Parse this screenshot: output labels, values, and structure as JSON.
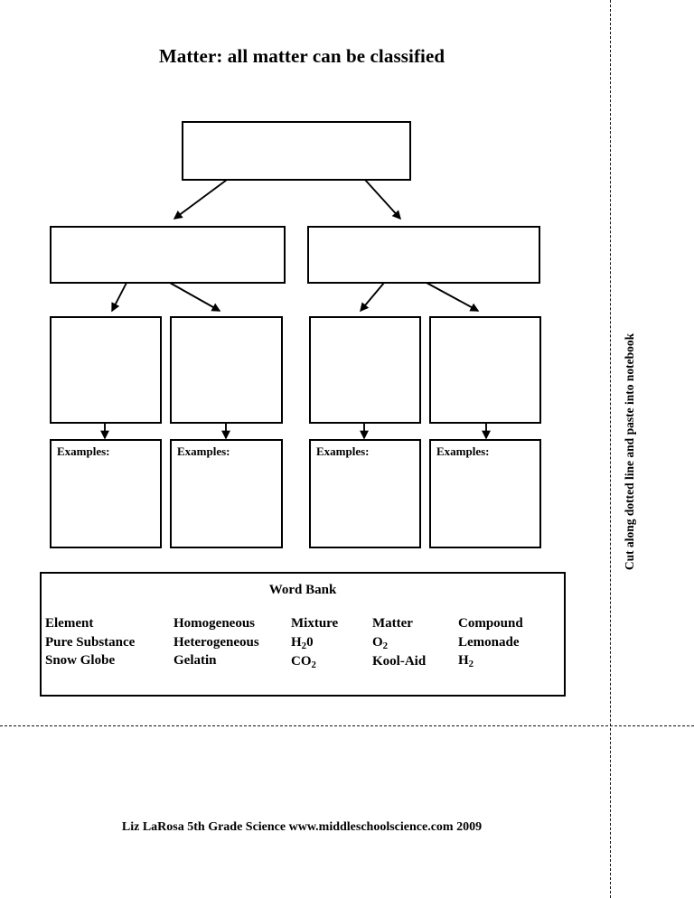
{
  "page": {
    "title": "Matter: all matter can be classified",
    "footer": "Liz LaRosa 5th Grade Science www.middleschoolscience.com 2009",
    "cut_note": "Cut along dotted line and paste into notebook"
  },
  "diagram": {
    "level1": [
      {
        "name": "matter-box",
        "label": ""
      }
    ],
    "level2": [
      {
        "name": "branch-box-left",
        "label": ""
      },
      {
        "name": "branch-box-right",
        "label": ""
      }
    ],
    "level3": [
      {
        "name": "category-box-1",
        "label": ""
      },
      {
        "name": "category-box-2",
        "label": ""
      },
      {
        "name": "category-box-3",
        "label": ""
      },
      {
        "name": "category-box-4",
        "label": ""
      }
    ],
    "examples": [
      {
        "name": "examples-box-1",
        "label": "Examples:"
      },
      {
        "name": "examples-box-2",
        "label": "Examples:"
      },
      {
        "name": "examples-box-3",
        "label": "Examples:"
      },
      {
        "name": "examples-box-4",
        "label": "Examples:"
      }
    ]
  },
  "word_bank": {
    "title": "Word Bank",
    "columns": [
      {
        "items": [
          "Element",
          "Pure Substance",
          "Snow Globe"
        ]
      },
      {
        "items": [
          "Homogeneous",
          "Heterogeneous",
          "Gelatin"
        ]
      },
      {
        "items": [
          "Mixture",
          "H<sub>2</sub>0",
          "CO<sub>2</sub>"
        ]
      },
      {
        "items": [
          "Matter",
          "O<sub>2</sub>",
          "Kool-Aid"
        ]
      },
      {
        "items": [
          "Compound",
          "Lemonade",
          "H<sub>2</sub>"
        ]
      }
    ]
  },
  "colors": {
    "ink": "#000000",
    "paper": "#ffffff"
  }
}
